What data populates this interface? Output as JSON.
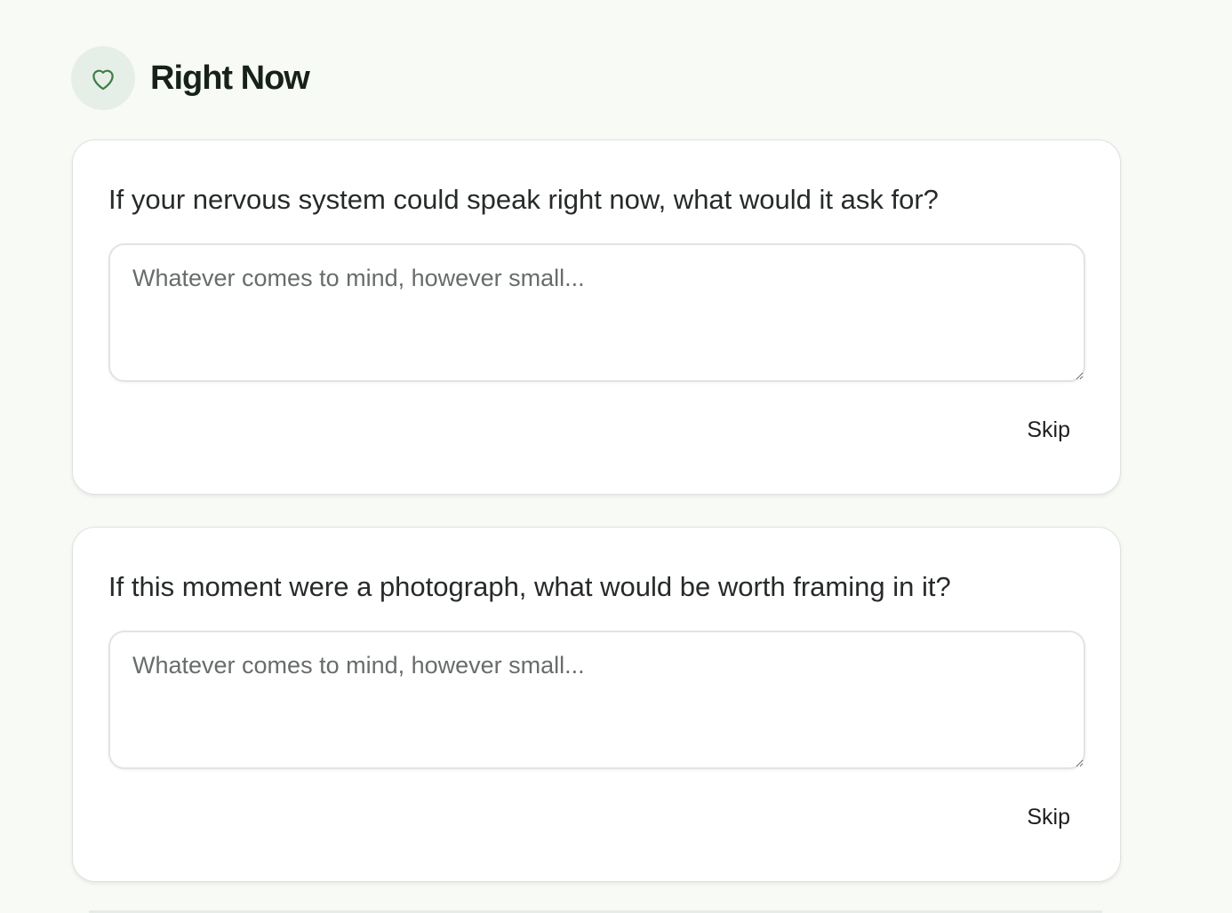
{
  "section": {
    "title": "Right Now",
    "icon": "heart-icon",
    "accent_color": "#3f7d46",
    "icon_bg_color": "#e6efe7"
  },
  "prompts": [
    {
      "question": "If your nervous system could speak right now, what would it ask for?",
      "answer_value": "",
      "placeholder": "Whatever comes to mind, however small...",
      "skip_label": "Skip"
    },
    {
      "question": "If this moment were a photograph, what would be worth framing in it?",
      "answer_value": "",
      "placeholder": "Whatever comes to mind, however small...",
      "skip_label": "Skip"
    }
  ]
}
